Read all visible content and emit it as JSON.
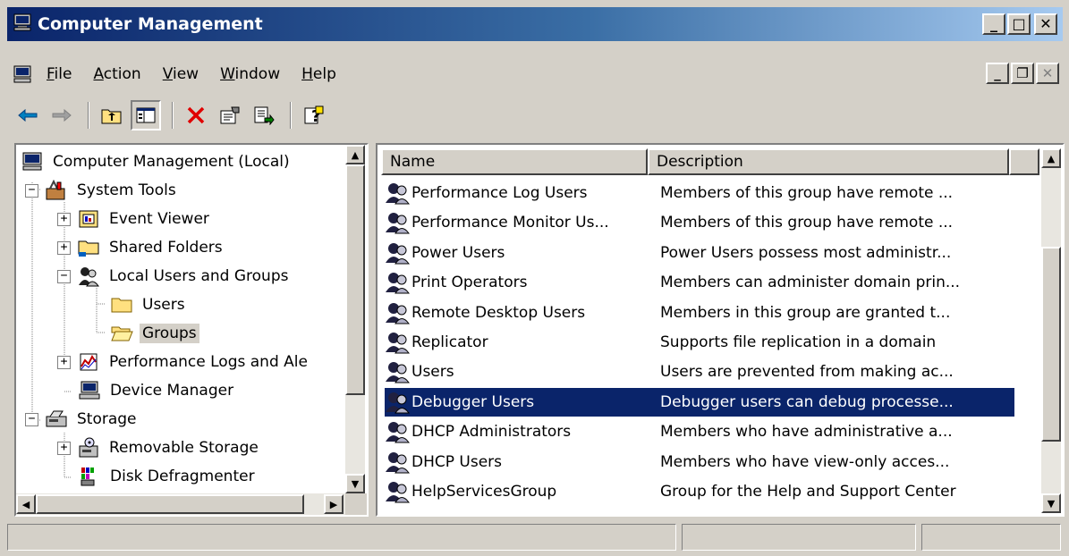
{
  "window": {
    "title": "Computer Management"
  },
  "menu": {
    "items": [
      "File",
      "Action",
      "View",
      "Window",
      "Help"
    ]
  },
  "tree": {
    "items": [
      {
        "label": "Computer Management (Local)"
      },
      {
        "label": "System Tools"
      },
      {
        "label": "Event Viewer"
      },
      {
        "label": "Shared Folders"
      },
      {
        "label": "Local Users and Groups"
      },
      {
        "label": "Users"
      },
      {
        "label": "Groups"
      },
      {
        "label": "Performance Logs and Ale"
      },
      {
        "label": "Device Manager"
      },
      {
        "label": "Storage"
      },
      {
        "label": "Removable Storage"
      },
      {
        "label": "Disk Defragmenter"
      }
    ]
  },
  "list": {
    "columns": [
      "Name",
      "Description"
    ],
    "rows": [
      {
        "name": "Performance Log Users",
        "description": "Members of this group have remote ..."
      },
      {
        "name": "Performance Monitor Us...",
        "description": "Members of this group have remote ..."
      },
      {
        "name": "Power Users",
        "description": "Power Users possess most administr..."
      },
      {
        "name": "Print Operators",
        "description": "Members can administer domain prin..."
      },
      {
        "name": "Remote Desktop Users",
        "description": "Members in this group are granted t..."
      },
      {
        "name": "Replicator",
        "description": "Supports file replication in a domain"
      },
      {
        "name": "Users",
        "description": "Users are prevented from making ac..."
      },
      {
        "name": "Debugger Users",
        "description": "Debugger users can debug processe..."
      },
      {
        "name": "DHCP Administrators",
        "description": "Members who have administrative a..."
      },
      {
        "name": "DHCP Users",
        "description": "Members who have view-only acces..."
      },
      {
        "name": "HelpServicesGroup",
        "description": "Group for the Help and Support Center"
      }
    ],
    "selected_row": "Debugger Users"
  },
  "colors": {
    "title_active": "#0a246a",
    "selection": "#0a246a",
    "face": "#d4d0c8"
  }
}
